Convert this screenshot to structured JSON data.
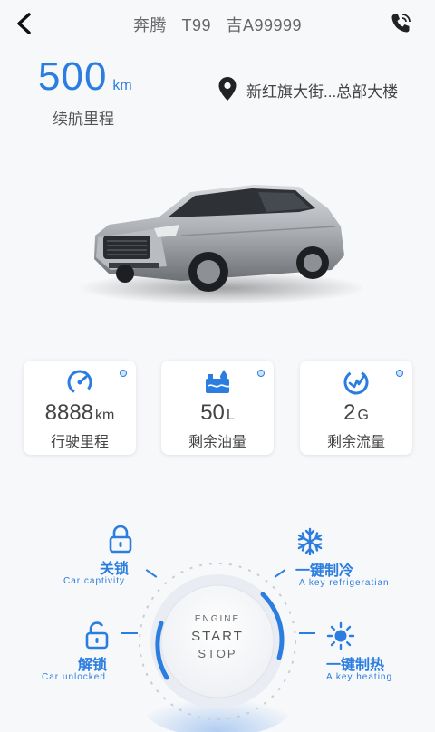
{
  "header": {
    "title": "奔腾   T99   吉A99999",
    "back_icon": "back-arrow-icon",
    "phone_icon": "phone-icon"
  },
  "range": {
    "value": "500",
    "unit": "km",
    "label": "续航里程"
  },
  "location": {
    "text": "新红旗大街...总部大楼",
    "icon": "location-pin-icon"
  },
  "stats": [
    {
      "value": "8888",
      "unit": "km",
      "label": "行驶里程",
      "icon": "speedometer-icon"
    },
    {
      "value": "50",
      "unit": "L",
      "label": "剩余油量",
      "icon": "fuel-tank-icon"
    },
    {
      "value": "2",
      "unit": "G",
      "label": "剩余流量",
      "icon": "data-flow-icon"
    }
  ],
  "controls": {
    "lock": {
      "cn": "关锁",
      "en": "Car captivity",
      "icon": "lock-icon"
    },
    "unlock": {
      "cn": "解锁",
      "en": "Car unlocked",
      "icon": "unlock-icon"
    },
    "cool": {
      "cn": "一键制冷",
      "en": "A key refrigeratian",
      "icon": "snowflake-icon"
    },
    "heat": {
      "cn": "一键制热",
      "en": "A key heating",
      "icon": "sun-icon"
    }
  },
  "engine": {
    "line1": "ENGINE",
    "line2": "START",
    "line3": "STOP"
  },
  "colors": {
    "accent": "#2b7de0",
    "background": "#f7f8fa"
  }
}
